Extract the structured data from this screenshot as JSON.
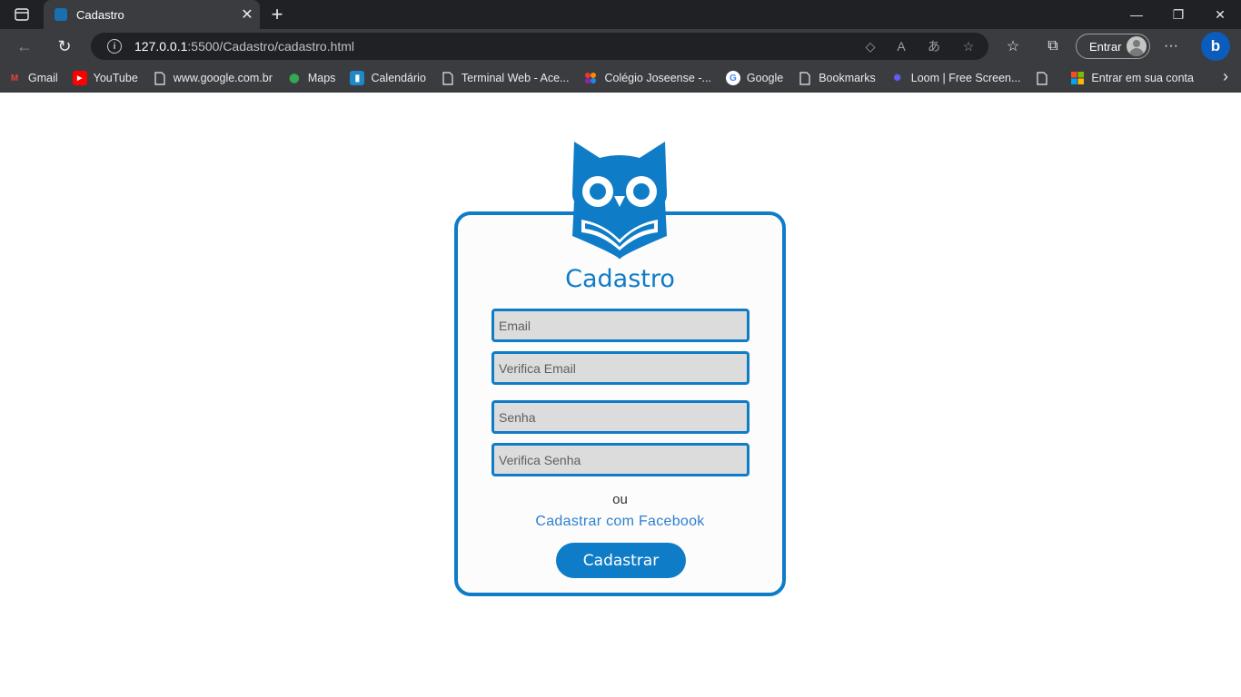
{
  "browser": {
    "tab": {
      "title": "Cadastro",
      "close": "✕"
    },
    "new_tab": "+",
    "window": {
      "minimize": "—",
      "maximize": "❐",
      "close": "✕"
    },
    "nav": {
      "back": "←",
      "reload": "↻"
    },
    "address": {
      "host": "127.0.0.1",
      "rest": ":5500/Cadastro/cadastro.html"
    },
    "signin_label": "Entrar",
    "menu": "···",
    "bing": "b"
  },
  "bookmarks": [
    {
      "label": "Gmail",
      "icon": "gmail-icon",
      "color": "#ea4335",
      "glyph": "M"
    },
    {
      "label": "YouTube",
      "icon": "youtube-icon",
      "color": "#ff0000",
      "glyph": "▶"
    },
    {
      "label": "www.google.com.br",
      "icon": "page-icon",
      "color": "",
      "glyph": ""
    },
    {
      "label": "Maps",
      "icon": "maps-icon",
      "color": "#34a853",
      "glyph": "⬤"
    },
    {
      "label": "Calendário",
      "icon": "calendar-icon",
      "color": "#1e88c9",
      "glyph": ""
    },
    {
      "label": "Terminal Web - Ace...",
      "icon": "page-icon",
      "color": "",
      "glyph": ""
    },
    {
      "label": "Colégio Joseense -...",
      "icon": "colegio-icon",
      "color": "#e53935",
      "glyph": ""
    },
    {
      "label": "Google",
      "icon": "google-icon",
      "color": "#ffffff",
      "glyph": "G"
    },
    {
      "label": "Bookmarks",
      "icon": "page-icon",
      "color": "",
      "glyph": ""
    },
    {
      "label": "Loom | Free Screen...",
      "icon": "loom-icon",
      "color": "#625df5",
      "glyph": "✺"
    },
    {
      "label": "",
      "icon": "page-icon",
      "color": "",
      "glyph": ""
    },
    {
      "label": "Entrar em sua conta",
      "icon": "microsoft-icon",
      "color": "",
      "glyph": ""
    }
  ],
  "form": {
    "title": "Cadastro",
    "email_placeholder": "Email",
    "verify_email_placeholder": "Verifica Email",
    "password_placeholder": "Senha",
    "verify_password_placeholder": "Verifica Senha",
    "or_text": "ou",
    "facebook_link": "Cadastrar com Facebook",
    "submit_label": "Cadastrar"
  },
  "colors": {
    "accent": "#0f7cc7",
    "field_bg": "#dcdcdc",
    "link": "#2d7fd0"
  }
}
